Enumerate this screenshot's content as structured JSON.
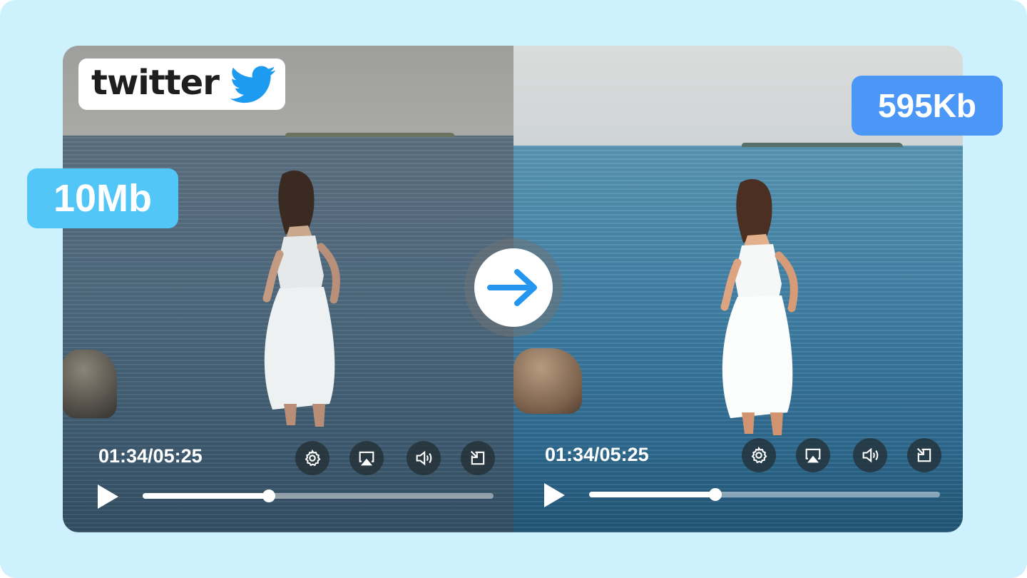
{
  "brand": {
    "name": "twitter",
    "bird_color": "#1d9bf0"
  },
  "sizes": {
    "original": "10Mb",
    "compressed": "595Kb",
    "original_color": "#52c6f7",
    "compressed_color": "#4a97f8"
  },
  "players": [
    {
      "id": "original",
      "timecode": "01:34/05:25",
      "progress": 0.36,
      "controls": [
        "settings-icon",
        "airplay-icon",
        "volume-icon",
        "exit-fullscreen-icon"
      ]
    },
    {
      "id": "compressed",
      "timecode": "01:34/05:25",
      "progress": 0.36,
      "controls": [
        "settings-icon",
        "airplay-icon",
        "volume-icon",
        "exit-fullscreen-icon"
      ]
    }
  ],
  "center": {
    "icon": "arrow-right-icon",
    "color": "#2596ef"
  }
}
